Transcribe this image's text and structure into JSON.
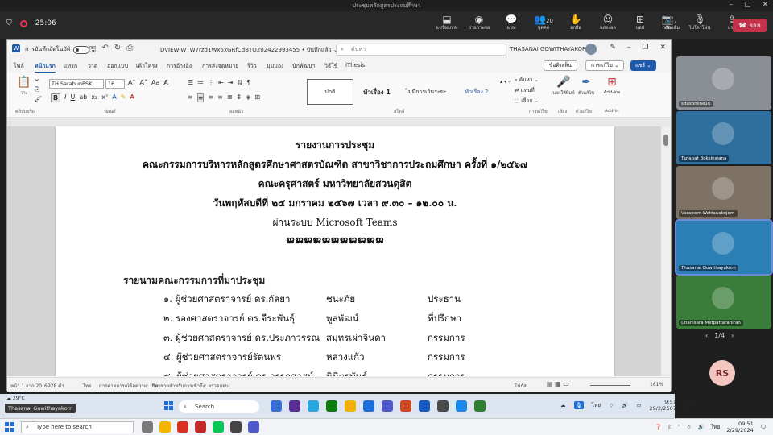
{
  "teams": {
    "window_title": "ประชุมหลักสูตรประถมศึกษา",
    "timer": "25:06",
    "tools": [
      {
        "icon": "share-screen-icon",
        "label": "แชร์จอภาพ",
        "glyph": "⬓"
      },
      {
        "icon": "record-icon",
        "label": "ถ่ายภาพจอ",
        "glyph": "◉"
      },
      {
        "icon": "chat-icon",
        "label": "แชท",
        "glyph": "💬"
      },
      {
        "icon": "people-icon",
        "label": "บุคคล",
        "glyph": "👥",
        "badge": "20"
      },
      {
        "icon": "raise-hand-icon",
        "label": "ยกมือ",
        "glyph": "✋"
      },
      {
        "icon": "react-icon",
        "label": "แสดงผล",
        "glyph": "☺"
      },
      {
        "icon": "apps-icon",
        "label": "แอป",
        "glyph": "⊞"
      },
      {
        "icon": "more-icon",
        "label": "เพิ่มเติม",
        "glyph": "…"
      }
    ],
    "right_tools": [
      {
        "icon": "camera-icon",
        "label": "กล้อง",
        "glyph": "📷"
      },
      {
        "icon": "mic-icon",
        "label": "ไมโครโฟน",
        "glyph": "🎙"
      },
      {
        "icon": "share-icon",
        "label": "แชร์",
        "glyph": "⇪"
      }
    ],
    "leave_label": "ออก"
  },
  "word": {
    "autosave_label": "การบันทึกอัตโนมัติ",
    "doc_name": "DVIEW-WTW7rzd1Wx5xGRfCdBTO202422993455 • บันทึกแล้ว ⌄",
    "search_placeholder": "ค้นหา",
    "user": "THASANAI GOWITHAYAKORN",
    "tabs": [
      "ไฟล์",
      "หน้าแรก",
      "แทรก",
      "วาด",
      "ออกแบบ",
      "เค้าโครง",
      "การอ้างอิง",
      "การส่งจดหมาย",
      "รีวิว",
      "มุมมอง",
      "นักพัฒนา",
      "วิธีใช้",
      "iThesis"
    ],
    "comments_label": "ข้อคิดเห็น",
    "editing_label": "การแก้ไข ⌄",
    "share_label": "แชร์ ⌄",
    "ribbon": {
      "font_name": "TH SarabunPSK",
      "font_size": "16",
      "paste_label": "วาง",
      "styles": [
        "ปกติ",
        "หัวเรื่อง 1",
        "ไม่มีการเว้นระยะ",
        "หัวเรื่อง 2"
      ],
      "find_label": "ค้นหา ⌄",
      "replace_label": "แทนที่",
      "select_label": "เลือก ⌄",
      "dictate_label": "บอกให้พิมพ์",
      "editor_label": "ตัวแก้ไข",
      "addins_label": "Add-ins",
      "groups": [
        "คลิปบอร์ด",
        "ฟอนต์",
        "ย่อหน้า",
        "สไตล์",
        "การแก้ไข",
        "เสียง",
        "ตัวแก้ไข",
        "Add-in"
      ]
    },
    "document": {
      "lines": [
        "รายงานการประชุม",
        "คณะกรรมการบริหารหลักสูตรศึกษาศาสตรบัณฑิต สาขาวิชาการประถมศึกษา ครั้งที่ ๑/๒๕๖๗",
        "คณะครุศาสตร์ มหาวิทยาลัยสวนดุสิต",
        "วันพฤหัสบดีที่ ๒๕ มกราคม ๒๕๖๗  เวลา ๙.๓๐ – ๑๒.๐๐ น.",
        "ผ่านระบบ Microsoft Teams",
        "ജജജജജജജജജജജ"
      ],
      "members_title": "รายนามคณะกรรมการที่มาประชุม",
      "members": [
        {
          "name": "๑. ผู้ช่วยศาสตราจารย์ ดร.กัลยา",
          "surname": "ชนะภัย",
          "role": "ประธาน"
        },
        {
          "name": "๒. รองศาสตราจารย์ ดร.จีระพันธุ์",
          "surname": "พูลพัฒน์",
          "role": "ที่ปรึกษา"
        },
        {
          "name": "๓. ผู้ช่วยศาสตราจารย์ ดร.ประภาวรรณ",
          "surname": "สมุทรเผ่าจินดา",
          "role": "กรรมการ"
        },
        {
          "name": "๔. ผู้ช่วยศาสตราจารย์รัตนพร",
          "surname": "หลวงแก้ว",
          "role": "กรรมการ"
        },
        {
          "name": "๕. ผู้ช่วยศาสตราจารย์ ดร.อรรถศาสน์",
          "surname": "นิมิตรพันธ์",
          "role": "กรรมการ"
        }
      ]
    },
    "status": {
      "page": "หน้า 1 จาก 20",
      "words": "6928 คำ",
      "lang": "ไทย",
      "accessibility": "การช่วยสำหรับการเข้าถึง: ตรวจสอบ",
      "prediction": "การคาดการณ์ข้อความ: เปิด",
      "focus": "โฟกัส",
      "zoom": "161%"
    }
  },
  "participants": [
    {
      "name": "sdusonline10",
      "bg": "#8a8f96"
    },
    {
      "name": "Tanapat Boksinwana",
      "bg": "#2f6f9e"
    },
    {
      "name": "Varaporn Wattanakejorn",
      "bg": "#7d7263"
    },
    {
      "name": "Thasanai Gowithayakorn",
      "bg": "#2b7fb5",
      "selected": true
    },
    {
      "name": "Chanisara Metpattarahiran",
      "bg": "#3a7d3a"
    }
  ],
  "pager": "1/4",
  "rs_initials": "RS",
  "remote_taskbar": {
    "weather": "29°C",
    "search": "Search",
    "time": "9:51",
    "date": "29/2/2567",
    "lang": "ไทย"
  },
  "presenter": "Thasanai Gowithayakorn",
  "host_taskbar": {
    "search_placeholder": "Type here to search",
    "lang": "ไทย",
    "time": "09:51",
    "date": "2/29/2024"
  }
}
